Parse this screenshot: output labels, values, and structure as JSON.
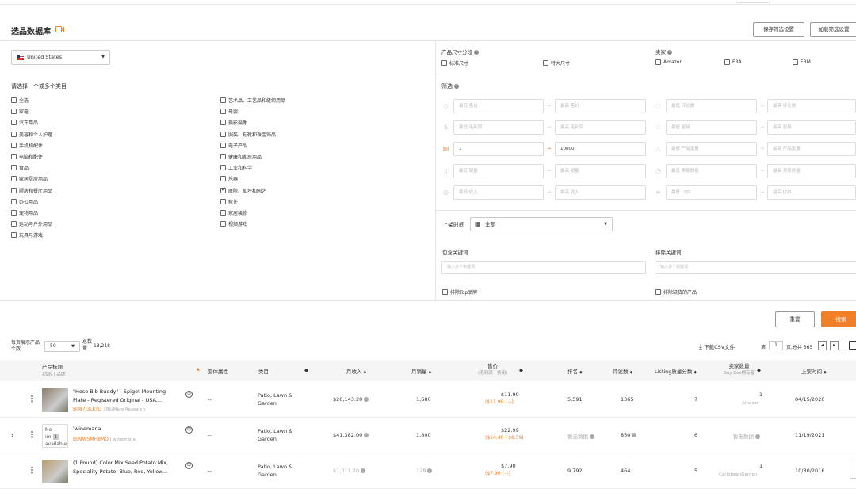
{
  "header": {
    "title": "选品数据库",
    "save_label": "保存筛选设置",
    "load_label": "加载筛选设置"
  },
  "marketplace": {
    "value": "United States"
  },
  "size": {
    "label": "产品尺寸分段",
    "options": [
      "标准尺寸",
      "特大尺寸"
    ]
  },
  "seller": {
    "label": "卖家",
    "options": [
      "Amazon",
      "FBA",
      "FBM"
    ]
  },
  "categories": {
    "label": "请选择一个或多个类目",
    "col1": [
      {
        "t": "全选",
        "c": false
      },
      {
        "t": "家电",
        "c": false
      },
      {
        "t": "汽车用品",
        "c": false
      },
      {
        "t": "美容和个人护理",
        "c": false
      },
      {
        "t": "手机和配件",
        "c": false
      },
      {
        "t": "电脑和配件",
        "c": false
      },
      {
        "t": "食品",
        "c": false
      },
      {
        "t": "家居厨房用品",
        "c": false
      },
      {
        "t": "厨房和餐厅用品",
        "c": false
      },
      {
        "t": "办公用品",
        "c": false
      },
      {
        "t": "宠物用品",
        "c": false
      },
      {
        "t": "运动与户外用品",
        "c": false
      },
      {
        "t": "玩具与游戏",
        "c": false
      }
    ],
    "col2": [
      {
        "t": "艺术品、工艺品和缝纫用品",
        "c": false
      },
      {
        "t": "母婴",
        "c": false
      },
      {
        "t": "摄影摄像",
        "c": false
      },
      {
        "t": "服装、鞋靴和珠宝饰品",
        "c": false
      },
      {
        "t": "电子产品",
        "c": false
      },
      {
        "t": "健康和家居用品",
        "c": false
      },
      {
        "t": "工业和科学",
        "c": false
      },
      {
        "t": "乐器",
        "c": false
      },
      {
        "t": "庭院、草坪和园艺",
        "c": true
      },
      {
        "t": "软件",
        "c": false
      },
      {
        "t": "家居装修",
        "c": false
      },
      {
        "t": "视频游戏",
        "c": false
      }
    ]
  },
  "filters": {
    "label": "筛选",
    "left": [
      {
        "icon": "price-tag-icon",
        "glyph": "◇",
        "min": "最低 售价",
        "max": "最高 售价",
        "active": false
      },
      {
        "icon": "profit-icon",
        "glyph": "$",
        "min": "最低 毛利润",
        "max": "最高 毛利润",
        "active": false
      },
      {
        "icon": "bar-chart-icon",
        "glyph": "▥",
        "min": "1",
        "max": "10000",
        "active": true
      },
      {
        "icon": "sales-icon",
        "glyph": "▯",
        "min": "最低 销量",
        "max": "最高 销量",
        "active": false
      },
      {
        "icon": "revenue-icon",
        "glyph": "◎",
        "min": "最低 收入",
        "max": "最高 收入",
        "active": false
      }
    ],
    "right": [
      {
        "icon": "review-icon",
        "glyph": "◌",
        "min": "最低 评论数",
        "max": "最高 评论数"
      },
      {
        "icon": "star-icon",
        "glyph": "☆",
        "min": "最低 星级",
        "max": "最高 星级"
      },
      {
        "icon": "weight-icon",
        "glyph": "△",
        "min": "最低 产品重量",
        "max": "最高 产品重量"
      },
      {
        "icon": "seller-count-icon",
        "glyph": "◔",
        "min": "最低 卖家数量",
        "max": "最高 卖家数量"
      },
      {
        "icon": "lqs-icon",
        "glyph": "≡",
        "min": "最低 LQS",
        "max": "最高 LQS"
      }
    ]
  },
  "listing_time": {
    "label": "上架时间",
    "value": "全部"
  },
  "keywords": {
    "include_label": "包含关键词",
    "exclude_label": "排除关键词",
    "include_ph": "输入多个关键词",
    "exclude_ph": "输入多个关键词"
  },
  "excl": {
    "top_brands": "排除Top品牌",
    "oos": "排除缺货的产品"
  },
  "actions": {
    "reset": "重置",
    "search": "搜索"
  },
  "table_ctrl": {
    "per_page_label": "每页展示产品个数",
    "per_page": "50",
    "total_label": "总数量",
    "total": "18,218",
    "download": "下载CSV文件",
    "page_prefix": "第",
    "page": "1",
    "page_suffix": "页,总共 365"
  },
  "columns": {
    "title": "产品标题",
    "title_sub": "ASIN | 品牌",
    "variant": "变体属性",
    "category": "类目",
    "revenue": "月收入",
    "sales": "月销量",
    "price": "售价",
    "price_sub": "(毛利润 | 费用)",
    "rank": "排名",
    "reviews": "评论数",
    "lqs": "Listing质量分数",
    "sellers": "卖家数量",
    "sellers_sub": "Buy Box拥有者",
    "date": "上架时间"
  },
  "rows": [
    {
      "title1": "\"Hose Bib Buddy\" - Spigot Mounting",
      "title2": "Plate - Registered Original - USA....",
      "asin": "B087J3LKYD",
      "brand": "BluMare Research",
      "variant": "--",
      "category1": "Patio, Lawn &",
      "category2": "Garden",
      "revenue": "$20,143.20",
      "sales": "1,680",
      "price": "$11.99",
      "price_sub": "($11.99 | --)",
      "rank": "5,591",
      "reviews": "1365",
      "lqs": "7",
      "sellers": "1",
      "bb": "Amazon",
      "date": "04/15/2020"
    },
    {
      "title1": "'winemana",
      "title2": "",
      "asin": "B09W5MH8MQ",
      "brand": "winemana",
      "variant": "--",
      "category1": "Patio, Lawn &",
      "category2": "Garden",
      "revenue": "$41,382.00",
      "sales": "1,800",
      "price": "$22.99",
      "price_sub": "($14.40 | $8.59)",
      "rank": "暂无数据",
      "reviews": "850",
      "lqs": "6",
      "sellers": "暂无数据",
      "bb": "",
      "date": "11/19/2021",
      "noimg1": "No im",
      "noimg_badge": "1",
      "noimg2": "availabie"
    },
    {
      "title1": "(1 Pound) Color Mix Seed Potato Mix,",
      "title2": "Speciality Potato, Blue, Red, Yellow...",
      "asin": "",
      "brand": "",
      "variant": "--",
      "category1": "Patio, Lawn &",
      "category2": "Garden",
      "revenue": "$1,011.20",
      "sales": "128",
      "price": "$7.90",
      "price_sub": "($7.90 | --)",
      "rank": "9,792",
      "reviews": "464",
      "lqs": "5",
      "sellers": "1",
      "bb": "CaribbeanGarden",
      "date": "10/30/2016"
    }
  ],
  "colors": {
    "accent": "#f07f2a",
    "link": "#f07f2a",
    "check": "#333333"
  }
}
